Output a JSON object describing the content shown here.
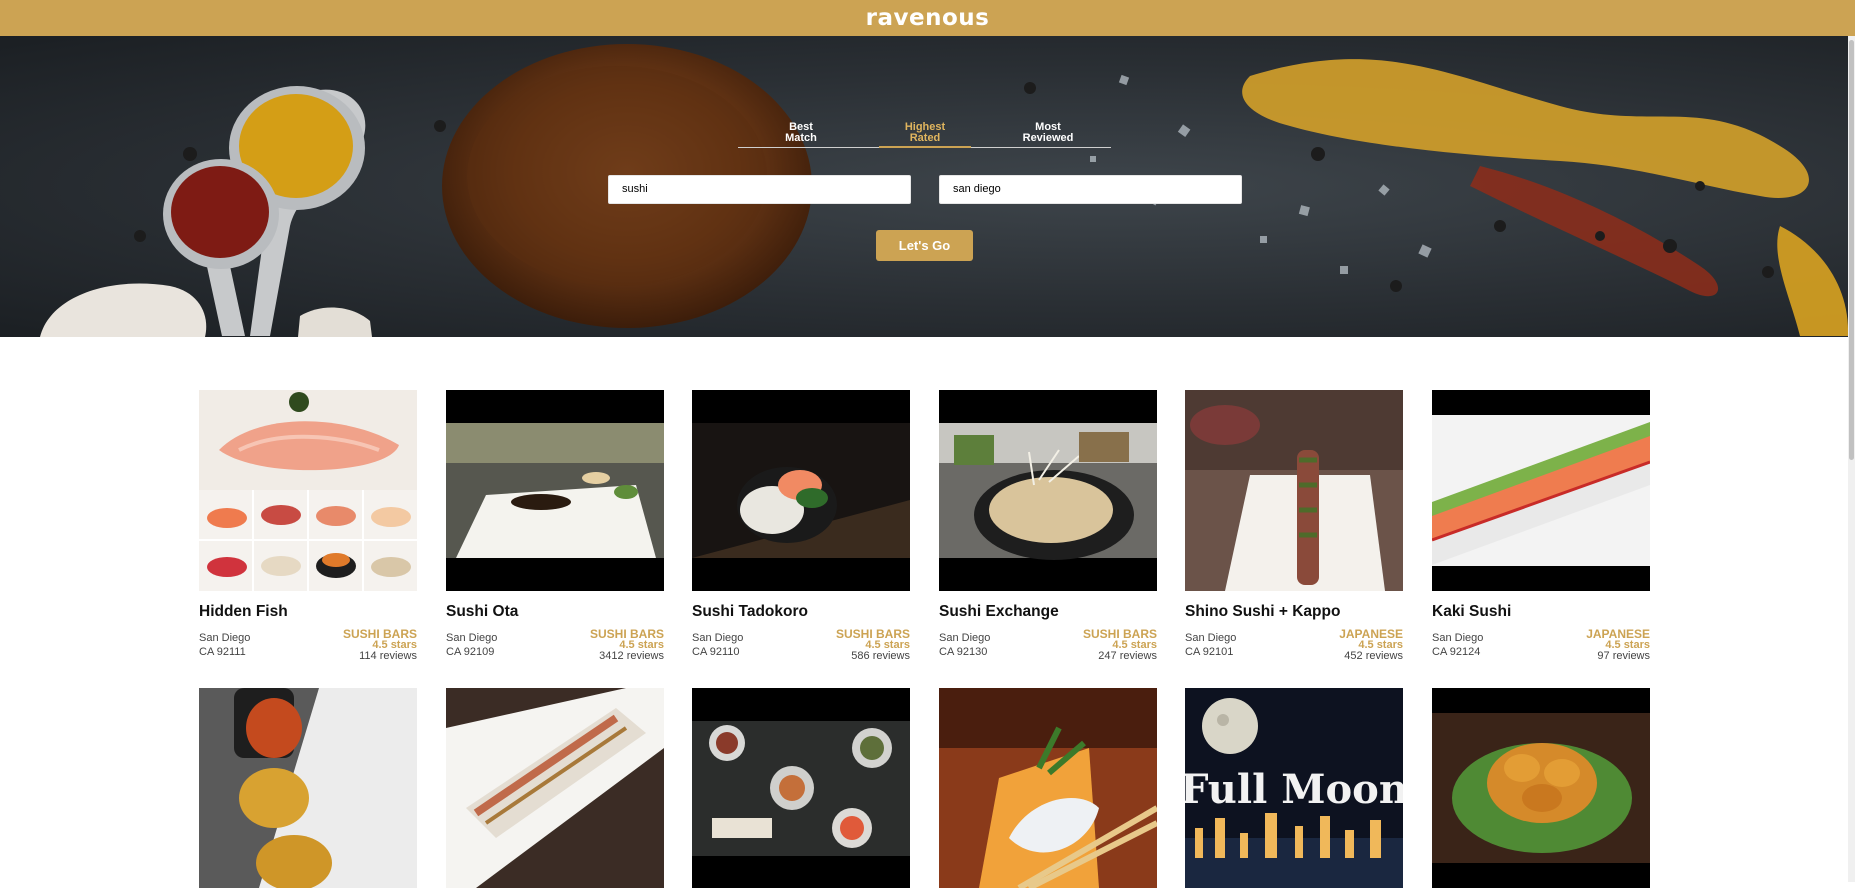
{
  "app": {
    "logo": "ravenous"
  },
  "sort": {
    "options": [
      {
        "line1": "Best",
        "line2": "Match",
        "active": false
      },
      {
        "line1": "Highest",
        "line2": "Rated",
        "active": true
      },
      {
        "line1": "Most",
        "line2": "Reviewed",
        "active": false
      }
    ]
  },
  "search": {
    "term_value": "sushi",
    "location_value": "san diego",
    "submit_label": "Let's Go"
  },
  "colors": {
    "accent": "#cca353",
    "topbar": "#cca353"
  },
  "businesses": [
    {
      "name": "Hidden Fish",
      "city": "San Diego",
      "state_zip": "CA 92111",
      "category": "SUSHI BARS",
      "rating": "4.5 stars",
      "reviews": "114 reviews"
    },
    {
      "name": "Sushi Ota",
      "city": "San Diego",
      "state_zip": "CA 92109",
      "category": "SUSHI BARS",
      "rating": "4.5 stars",
      "reviews": "3412 reviews"
    },
    {
      "name": "Sushi Tadokoro",
      "city": "San Diego",
      "state_zip": "CA 92110",
      "category": "SUSHI BARS",
      "rating": "4.5 stars",
      "reviews": "586 reviews"
    },
    {
      "name": "Sushi Exchange",
      "city": "San Diego",
      "state_zip": "CA 92130",
      "category": "SUSHI BARS",
      "rating": "4.5 stars",
      "reviews": "247 reviews"
    },
    {
      "name": "Shino Sushi + Kappo",
      "city": "San Diego",
      "state_zip": "CA 92101",
      "category": "JAPANESE",
      "rating": "4.5 stars",
      "reviews": "452 reviews"
    },
    {
      "name": "Kaki Sushi",
      "city": "San Diego",
      "state_zip": "CA 92124",
      "category": "JAPANESE",
      "rating": "4.5 stars",
      "reviews": "97 reviews"
    }
  ],
  "row2_photo_text": {
    "full_moon": "Full Moon"
  }
}
